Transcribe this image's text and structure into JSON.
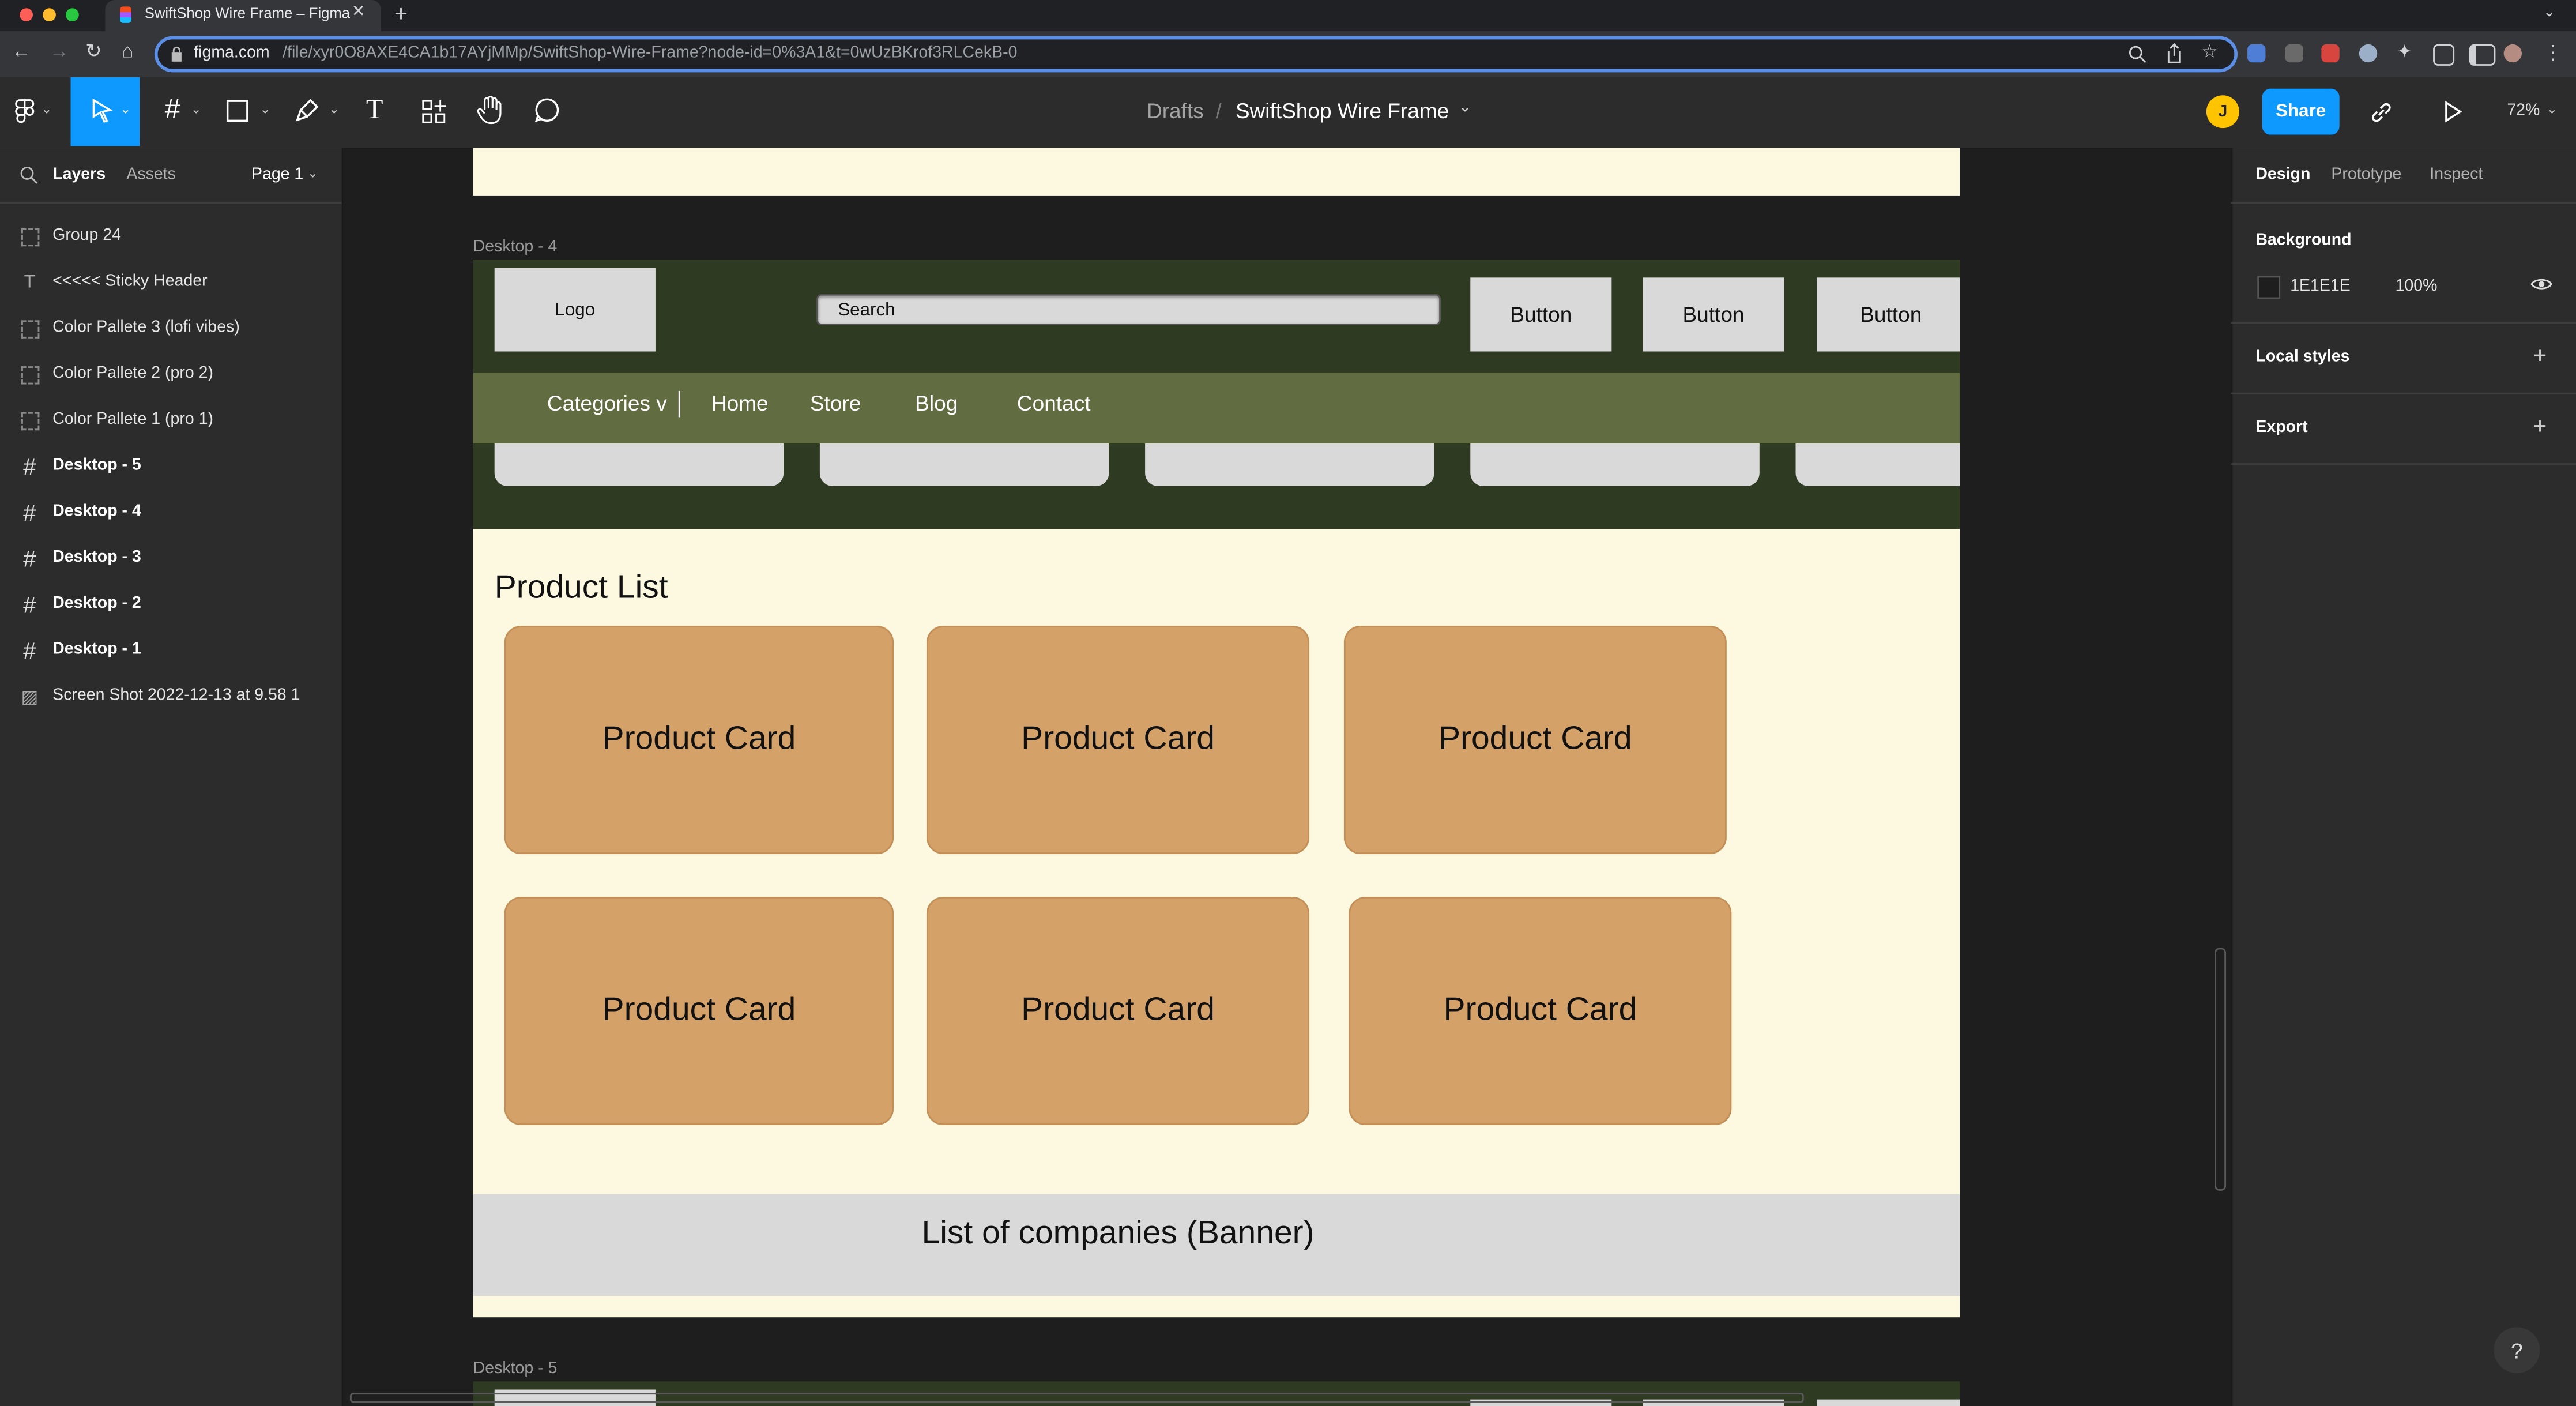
{
  "browser": {
    "tab_title": "SwiftShop Wire Frame – Figma",
    "url_host": "figma.com",
    "url_path": "/file/xyr0O8AXE4CA1b17AYjMMp/SwiftShop-Wire-Frame?node-id=0%3A1&t=0wUzBKrof3RLCekB-0"
  },
  "toolbar": {
    "breadcrumb_drafts": "Drafts",
    "breadcrumb_sep": "/",
    "file_name": "SwiftShop Wire Frame",
    "avatar_initial": "J",
    "share_label": "Share",
    "zoom": "72%"
  },
  "left_panel": {
    "tab_layers": "Layers",
    "tab_assets": "Assets",
    "page": "Page 1",
    "layers": [
      {
        "label": "Group 24",
        "type": "group"
      },
      {
        "label": "<<<<< Sticky Header",
        "type": "text"
      },
      {
        "label": "Color Pallete 3 (lofi vibes)",
        "type": "group"
      },
      {
        "label": "Color Pallete 2 (pro 2)",
        "type": "group"
      },
      {
        "label": "Color Pallete 1 (pro 1)",
        "type": "group"
      },
      {
        "label": "Desktop - 5",
        "type": "frame"
      },
      {
        "label": "Desktop - 4",
        "type": "frame"
      },
      {
        "label": "Desktop - 3",
        "type": "frame"
      },
      {
        "label": "Desktop - 2",
        "type": "frame"
      },
      {
        "label": "Desktop - 1",
        "type": "frame"
      },
      {
        "label": "Screen Shot 2022-12-13 at 9.58 1",
        "type": "image"
      }
    ]
  },
  "right_panel": {
    "tab_design": "Design",
    "tab_prototype": "Prototype",
    "tab_inspect": "Inspect",
    "background_heading": "Background",
    "background_hex": "1E1E1E",
    "background_opacity": "100%",
    "local_styles": "Local styles",
    "export": "Export",
    "help": "?"
  },
  "canvas": {
    "frame4_name": "Desktop - 4",
    "frame5_name": "Desktop - 5",
    "logo": "Logo",
    "search": "Search",
    "buttons": [
      "Button",
      "Button",
      "Button"
    ],
    "nav": [
      "Categories v",
      "Home",
      "Store",
      "Blog",
      "Contact"
    ],
    "product_list_title": "Product List",
    "product_cards": [
      "Product Card",
      "Product Card",
      "Product Card",
      "Product Card",
      "Product Card",
      "Product Card"
    ],
    "banner": "List of companies (Banner)"
  },
  "colors": {
    "figma_blue": "#0d99ff",
    "frame_background": "#fdf9e1",
    "header_dark": "#2f3a22",
    "nav_green": "#616c40",
    "card_tan": "#d4a168",
    "placeholder_gray": "#d9d9d9"
  }
}
